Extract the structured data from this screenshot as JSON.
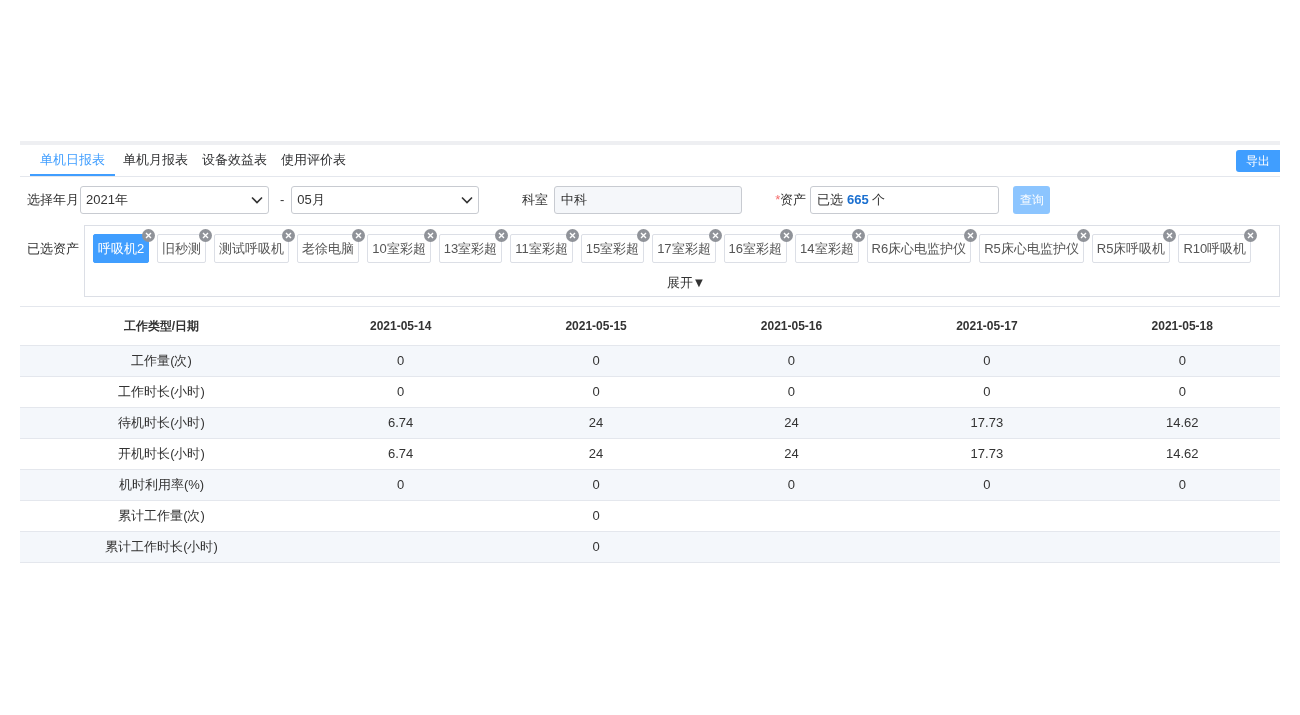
{
  "tabs": [
    {
      "label": "单机日报表",
      "selected": true
    },
    {
      "label": "单机月报表",
      "selected": false
    },
    {
      "label": "设备效益表",
      "selected": false
    },
    {
      "label": "使用评价表",
      "selected": false
    }
  ],
  "export_button": "导出",
  "filters": {
    "date_label": "选择年月",
    "year": "2021年",
    "separator": "-",
    "month": "05月",
    "dept_label": "科室",
    "dept_value": "中科",
    "asset_required": "*",
    "asset_label": "资产",
    "asset_value": "已选 **665** 个",
    "query_button": "查询"
  },
  "selected_assets": {
    "label": "已选资产",
    "expand": "展开▼",
    "tags": [
      {
        "label": "呼吸机2",
        "selected": true
      },
      {
        "label": "旧秒测",
        "selected": false
      },
      {
        "label": "测试呼吸机",
        "selected": false
      },
      {
        "label": "老徐电脑",
        "selected": false
      },
      {
        "label": "10室彩超",
        "selected": false
      },
      {
        "label": "13室彩超",
        "selected": false
      },
      {
        "label": "11室彩超",
        "selected": false
      },
      {
        "label": "15室彩超",
        "selected": false
      },
      {
        "label": "17室彩超",
        "selected": false
      },
      {
        "label": "16室彩超",
        "selected": false
      },
      {
        "label": "14室彩超",
        "selected": false
      },
      {
        "label": "R6床心电监护仪",
        "selected": false
      },
      {
        "label": "R5床心电监护仪",
        "selected": false
      },
      {
        "label": "R5床呼吸机",
        "selected": false
      },
      {
        "label": "R10呼吸机",
        "selected": false
      }
    ]
  },
  "table": {
    "columns": [
      "工作类型/日期",
      "2021-05-14",
      "2021-05-15",
      "2021-05-16",
      "2021-05-17",
      "2021-05-18"
    ],
    "rows": [
      [
        "工作量(次)",
        "0",
        "0",
        "0",
        "0",
        "0"
      ],
      [
        "工作时长(小时)",
        "0",
        "0",
        "0",
        "0",
        "0"
      ],
      [
        "待机时长(小时)",
        "6.74",
        "24",
        "24",
        "17.73",
        "14.62"
      ],
      [
        "开机时长(小时)",
        "6.74",
        "24",
        "24",
        "17.73",
        "14.62"
      ],
      [
        "机时利用率(%)",
        "0",
        "0",
        "0",
        "0",
        "0"
      ],
      [
        "累计工作量(次)",
        null,
        "0",
        null,
        null,
        null
      ],
      [
        "累计工作时长(小时)",
        null,
        "0",
        null,
        null,
        null
      ]
    ]
  }
}
